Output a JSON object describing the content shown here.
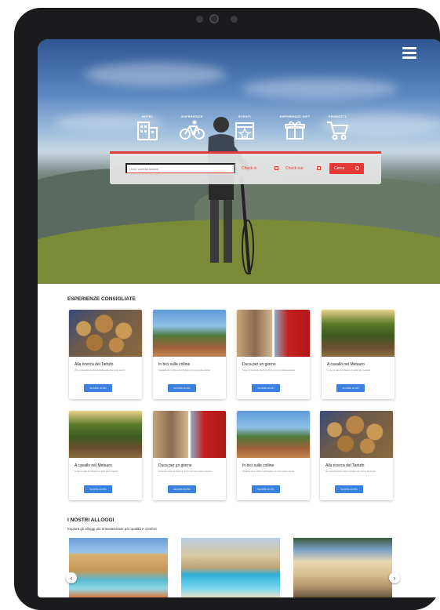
{
  "nav": {
    "menu_icon": "hamburger-icon"
  },
  "categories": [
    {
      "label": "HOTEL",
      "icon": "hotel-icon"
    },
    {
      "label": "ESPERIENZE",
      "icon": "bicycle-icon"
    },
    {
      "label": "EVENTI",
      "icon": "calendar-star-icon"
    },
    {
      "label": "ESPERIENZE GIFT",
      "icon": "gift-icon"
    },
    {
      "label": "PRODOTTI",
      "icon": "cart-icon"
    }
  ],
  "search": {
    "destination_placeholder": "Dove vorresti andare",
    "checkin_label": "Check in",
    "checkout_label": "Check out",
    "button_label": "Cerca"
  },
  "experiences": {
    "title": "ESPERIENZE CONSIGLIATE",
    "button_label": "SCOPRI DI PIÙ",
    "row1": [
      {
        "title": "Alla ricerca del Tartufo",
        "desc": "Vivi un'esperienza indimenticabile alla ricerca del tartufo",
        "image": "truffle"
      },
      {
        "title": "In bici sulle colline",
        "desc": "Pedalate tra le colline marchigiane con una guida esperta",
        "image": "hills"
      },
      {
        "title": "Duca per un giorno",
        "desc": "Scopri la storia dei duchi di Urbino con una visita esclusiva",
        "image": "art"
      },
      {
        "title": "A cavallo nel Metauro",
        "desc": "Lungo la valle del Metauro in sella ad un cavallo",
        "image": "horse"
      }
    ],
    "row2": [
      {
        "title": "A cavallo nel Metauro",
        "desc": "Lungo la valle del Metauro in sella ad un cavallo",
        "image": "horse"
      },
      {
        "title": "Duca per un giorno",
        "desc": "Scopri la storia dei duchi di Urbino con una visita esclusiva",
        "image": "art"
      },
      {
        "title": "In bici sulle colline",
        "desc": "Pedalate tra le colline marchigiane con una guida esperta",
        "image": "hills"
      },
      {
        "title": "Alla ricerca del Tartufo",
        "desc": "Vivi un'esperienza indimenticabile alla ricerca del tartufo",
        "image": "truffle"
      }
    ]
  },
  "stays": {
    "title": "I NOSTRI ALLOGGI",
    "subtitle": "Esplora gli alloggi più entusiasmanti per qualità e comfort",
    "prev_icon": "chevron-left-icon",
    "next_icon": "chevron-right-icon"
  },
  "colors": {
    "accent": "#e53935",
    "button_blue": "#3b82e0"
  }
}
